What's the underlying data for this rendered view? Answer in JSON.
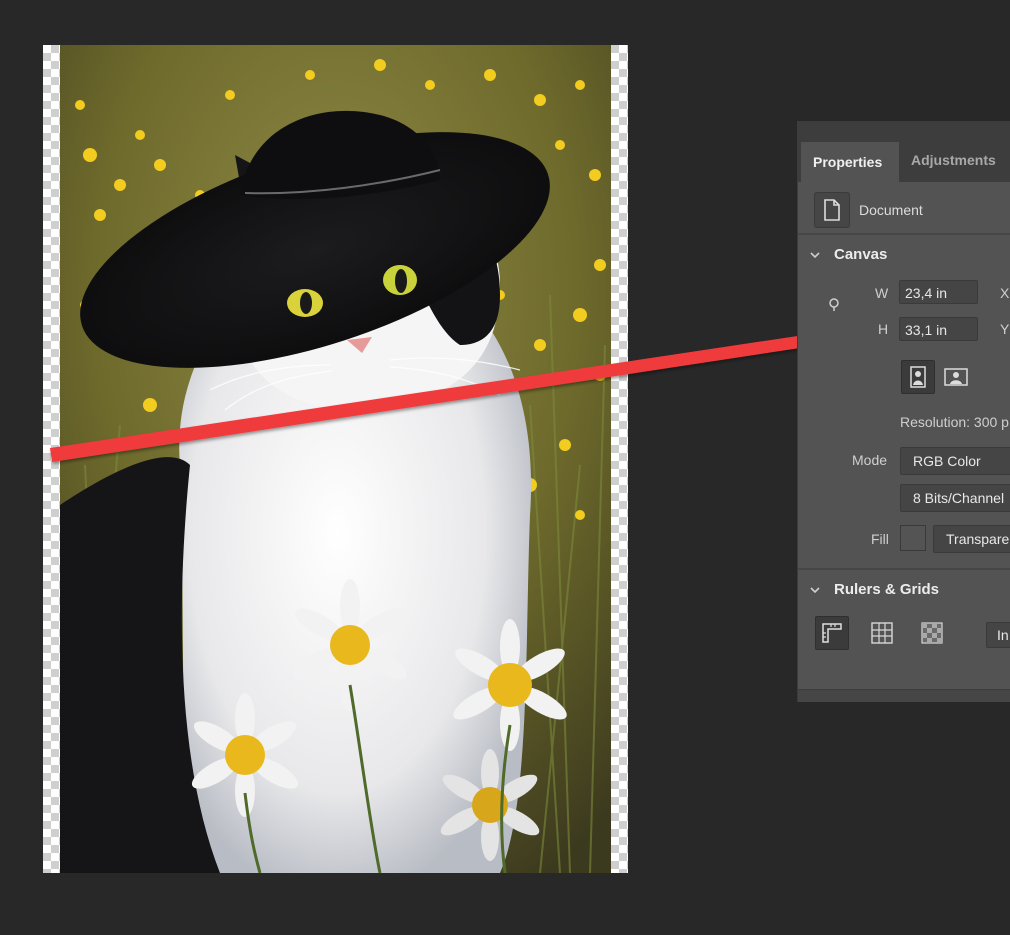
{
  "tabs": {
    "properties": "Properties",
    "adjustments": "Adjustments"
  },
  "document": {
    "label": "Document"
  },
  "canvas": {
    "title": "Canvas",
    "w_label": "W",
    "w_value": "23,4 in",
    "h_label": "H",
    "h_value": "33,1 in",
    "x_label": "X",
    "y_label": "Y",
    "resolution": "Resolution: 300 p",
    "mode_label": "Mode",
    "mode_value": "RGB Color",
    "bits_value": "8 Bits/Channel",
    "fill_label": "Fill",
    "fill_value": "Transpare"
  },
  "rulers": {
    "title": "Rulers & Grids",
    "units_value": "In"
  },
  "colors": {
    "arrow": "#ef3b3b",
    "panel": "#535353",
    "workspace": "#282828"
  },
  "icons": [
    "document-icon",
    "link-icon",
    "portrait-icon",
    "landscape-icon",
    "ruler-icon",
    "grid-icon",
    "transparency-grid-icon",
    "chevron-down-icon"
  ]
}
